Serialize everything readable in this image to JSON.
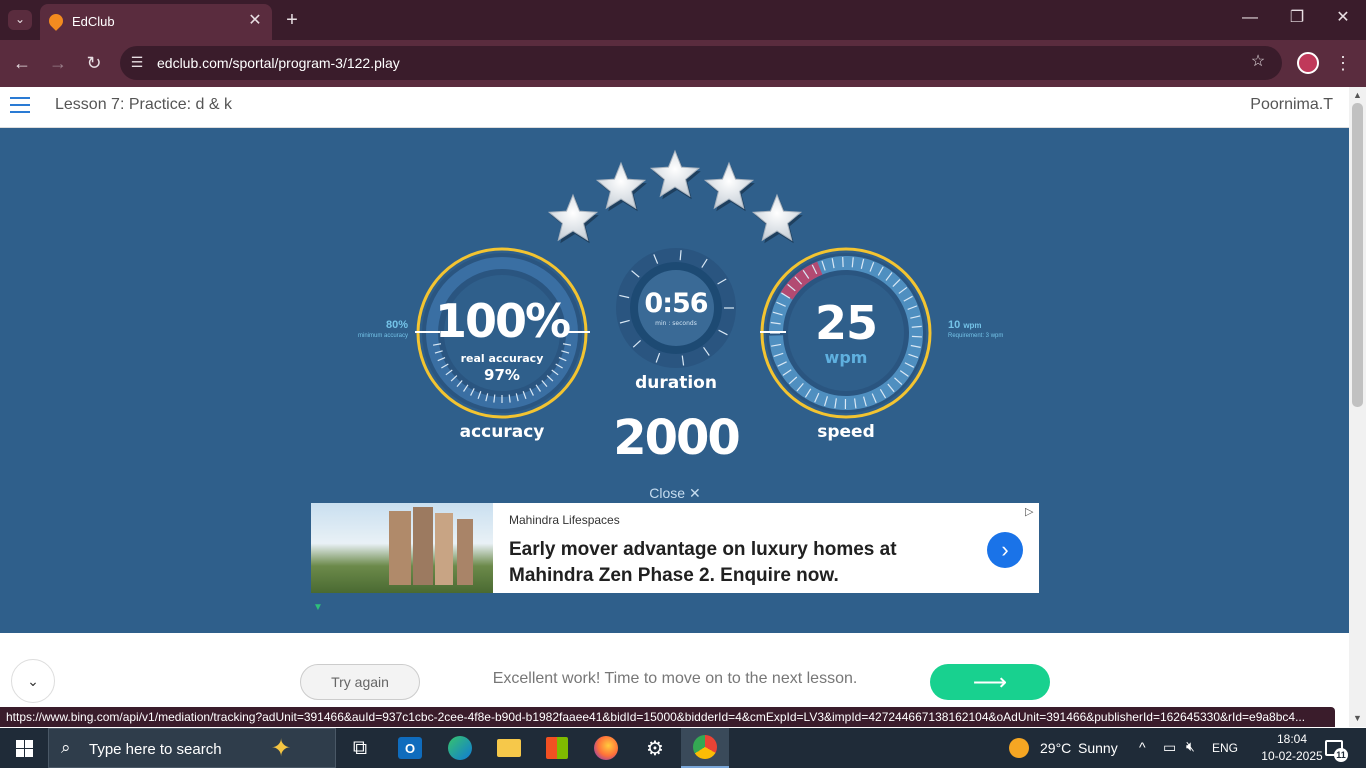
{
  "browser": {
    "tab_title": "EdClub",
    "url": "edclub.com/sportal/program-3/122.play",
    "status_url": "https://www.bing.com/api/v1/mediation/tracking?adUnit=391466&auId=937c1cbc-2cee-4f8e-b90d-b1982faaee41&bidId=15000&bidderId=4&cmExpId=LV3&impId=427244667138162104&oAdUnit=391466&publisherId=162645330&rId=e9a8bc4..."
  },
  "header": {
    "lesson_title": "Lesson 7: Practice: d & k",
    "user_name": "Poornima.T"
  },
  "results": {
    "stars": 5,
    "accuracy": {
      "value": "100%",
      "real_label": "real accuracy",
      "real_value": "97%",
      "caption": "accuracy",
      "minimum_value": "80%",
      "minimum_label": "minimum accuracy"
    },
    "duration": {
      "value": "0:56",
      "unit": "min : seconds",
      "caption": "duration"
    },
    "speed": {
      "value": "25",
      "unit": "wpm",
      "caption": "speed",
      "req_value": "10",
      "req_unit": "wpm",
      "req_label": "Requirement: 3 wpm"
    },
    "score": "2000",
    "close_label": "Close ✕"
  },
  "ad": {
    "advertiser": "Mahindra Lifespaces",
    "headline_line1": "Early mover advantage on luxury homes at",
    "headline_line2": "Mahindra Zen Phase 2. Enquire now."
  },
  "footer": {
    "try_again": "Try again",
    "message": "Excellent work! Time to move on to the next lesson.",
    "next_arrow": "⟶"
  },
  "taskbar": {
    "search_placeholder": "Type here to search",
    "weather_temp": "29°C",
    "weather_desc": "Sunny",
    "lang": "ENG",
    "time": "18:04",
    "date": "10-02-2025",
    "notification_count": "11"
  },
  "colors": {
    "stage_bg": "#2f5f8b",
    "gauge_ring": "#f3c431",
    "next_button": "#18d18f",
    "chrome_dark": "#3a1c2b"
  }
}
